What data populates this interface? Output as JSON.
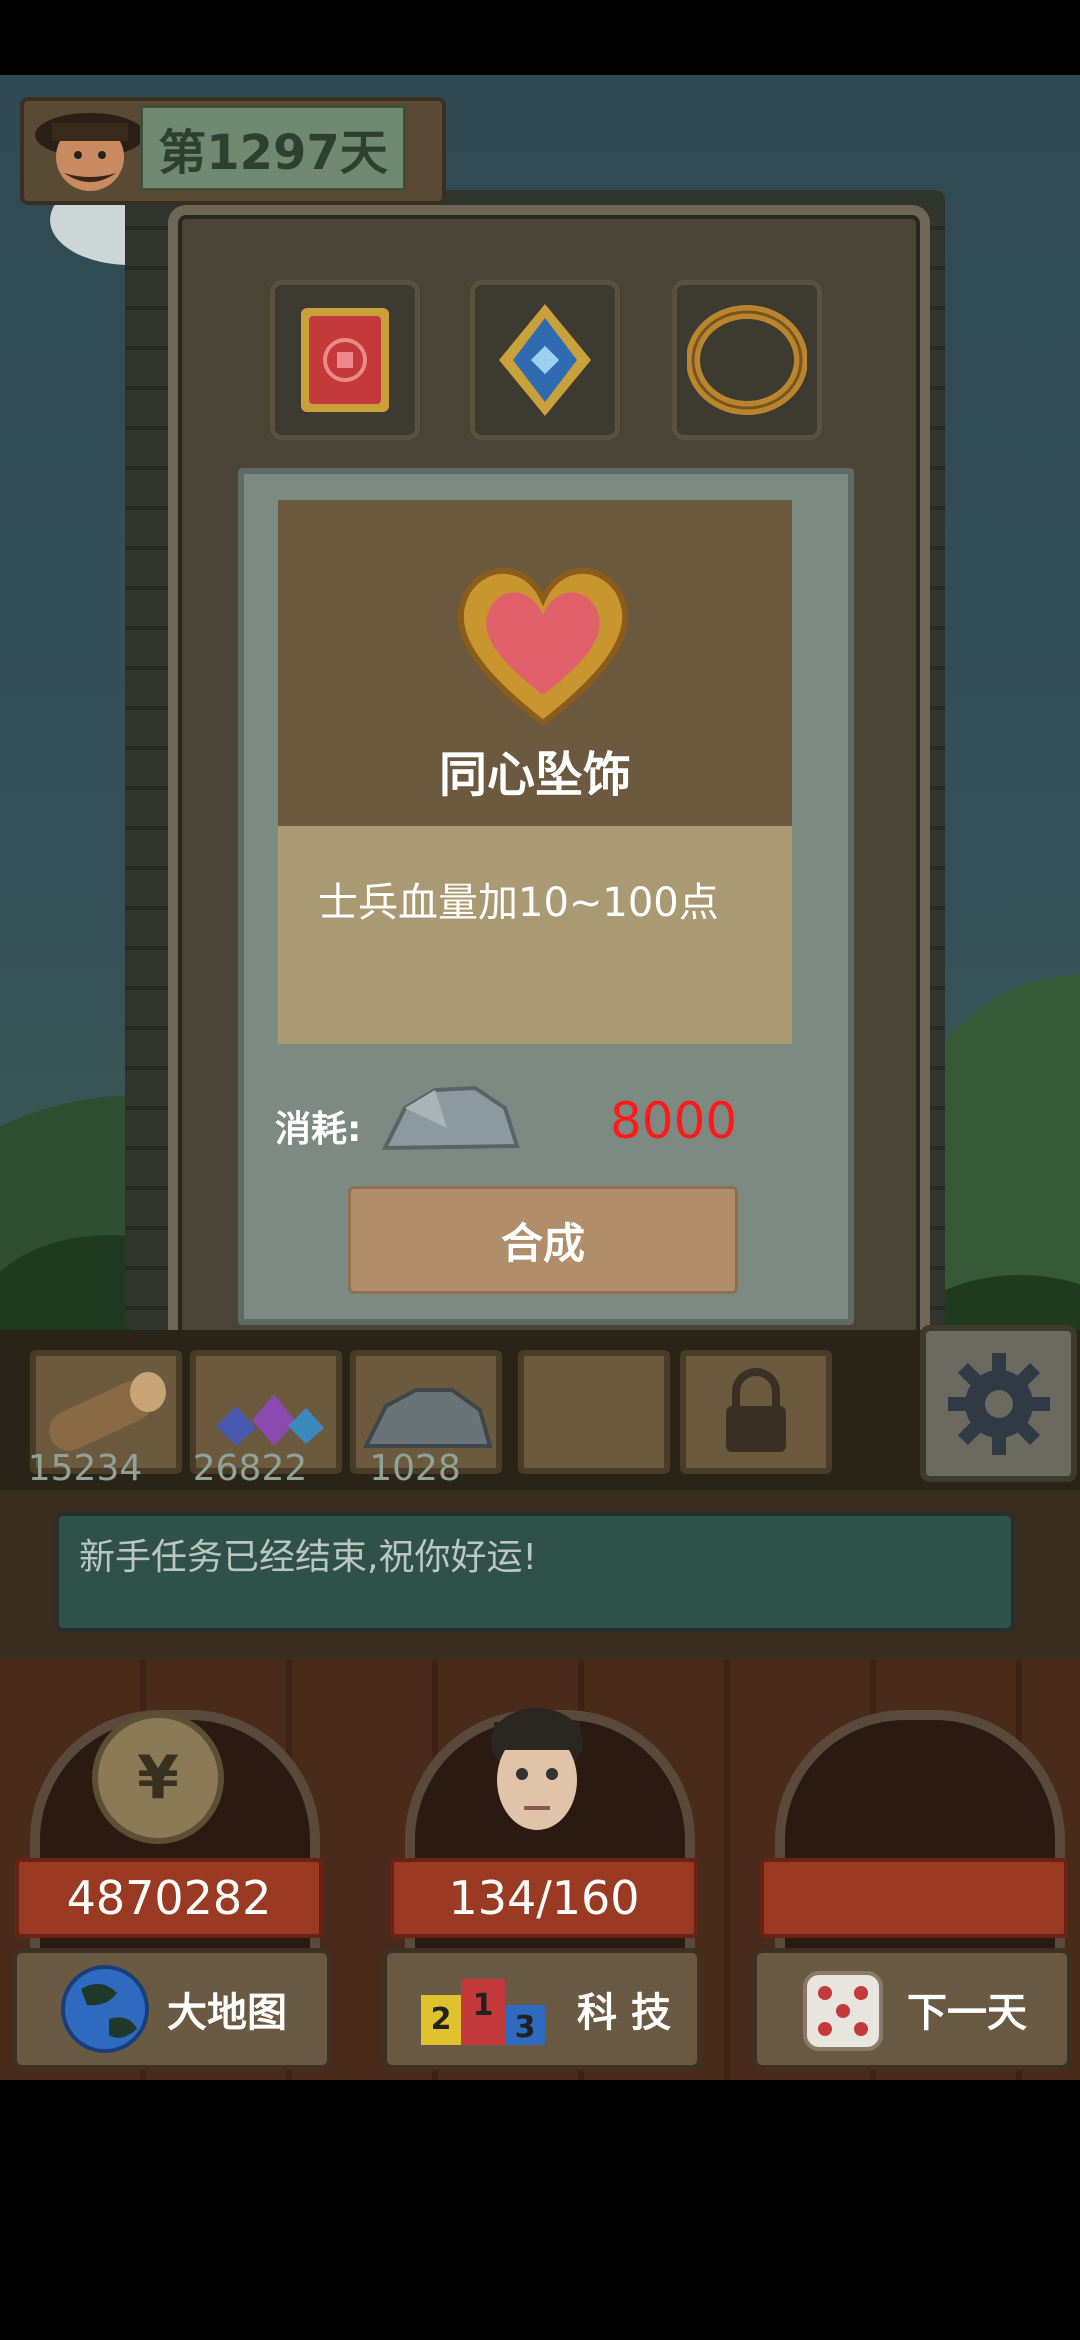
{
  "header": {
    "day_label": "第1297天"
  },
  "equipment_slots": [
    {
      "name": "red-card-icon",
      "color": "#c43a3a"
    },
    {
      "name": "blue-gem-amulet-icon",
      "color": "#2f6bb0"
    },
    {
      "name": "golden-ring-icon",
      "color": "#b8862f"
    }
  ],
  "item": {
    "name": "同心坠饰",
    "description": "士兵血量加10~100点",
    "icon": "heart-pendant-icon",
    "cost_label": "消耗:",
    "cost_resource_icon": "stone-icon",
    "cost_value": "8000",
    "craft_label": "合成"
  },
  "resources": [
    {
      "icon": "wood-log-icon",
      "count": "15234"
    },
    {
      "icon": "crystal-icon",
      "count": "26822"
    },
    {
      "icon": "stone-icon",
      "count": "1028"
    },
    {
      "icon": "empty-slot",
      "count": ""
    },
    {
      "icon": "lock-icon",
      "count": ""
    }
  ],
  "message": "新手任务已经结束,祝你好运!",
  "stats": {
    "money": "4870282",
    "population": "134/160"
  },
  "nav": {
    "map_label": "大地图",
    "tech_label": "科 技",
    "next_day_label": "下一天"
  },
  "tech_dice": [
    "2",
    "1",
    "3"
  ],
  "colors": {
    "cost_value": "#ff1a1a",
    "accent_ribbon": "#9a3a22"
  }
}
